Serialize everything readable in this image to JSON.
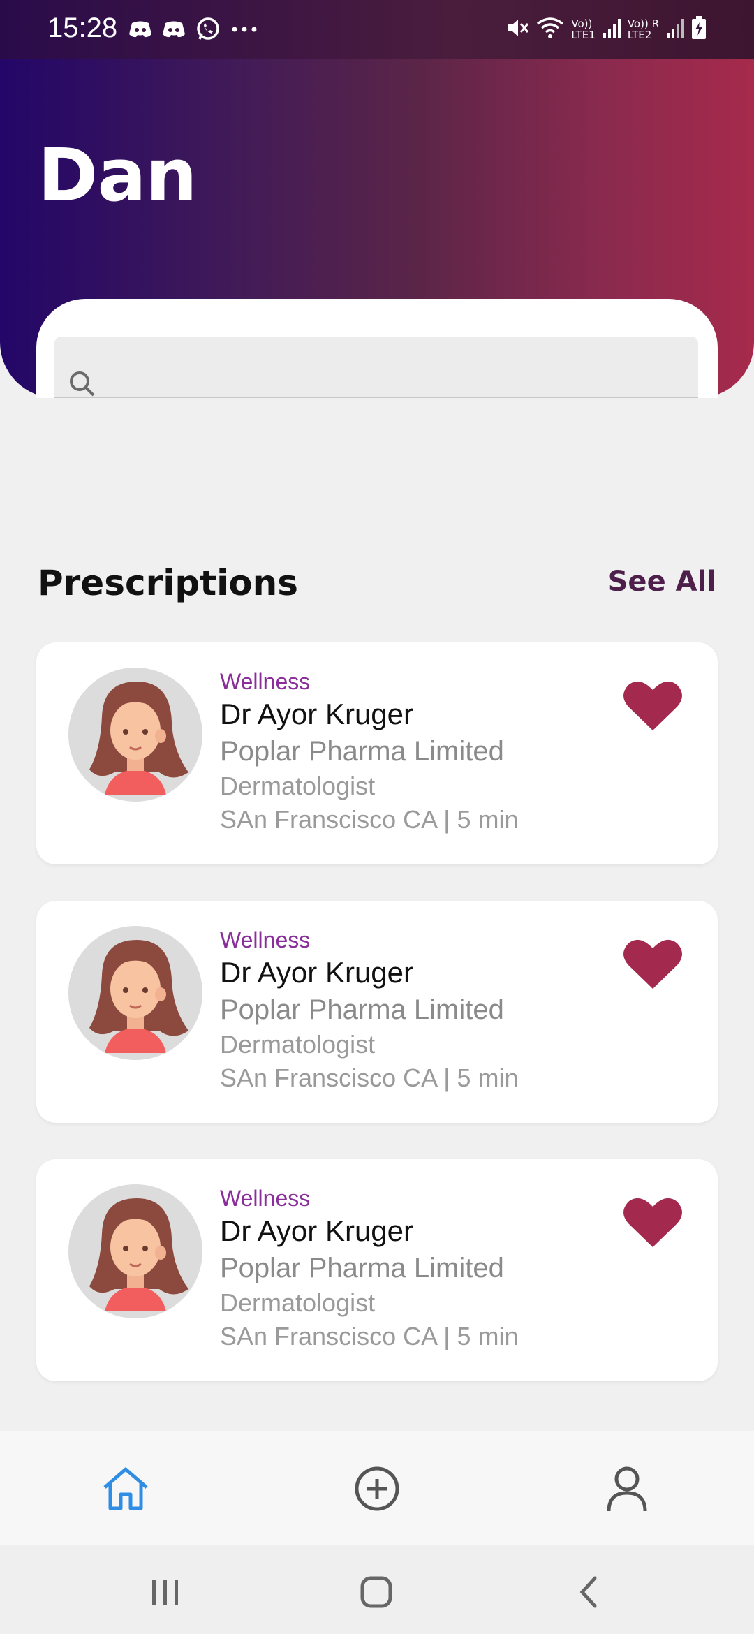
{
  "status_bar": {
    "time": "15:28",
    "left_icons": [
      "discord-icon",
      "discord-icon",
      "whatsapp-icon",
      "more-dots-icon"
    ],
    "right_icons": [
      "mute-icon",
      "wifi-icon",
      "signal-icon",
      "signal-icon",
      "battery-charging-icon"
    ],
    "sim1_top": "Vo))",
    "sim1_bottom": "LTE1",
    "sim2_top": "Vo)) R",
    "sim2_bottom": "LTE2"
  },
  "header": {
    "title": "Dan",
    "gradient_colors": [
      "#230668",
      "#a62a4c"
    ]
  },
  "search": {
    "placeholder": "",
    "value": "",
    "icon": "search-icon"
  },
  "prescriptions": {
    "title": "Prescriptions",
    "see_all": "See All",
    "items": [
      {
        "category": "Wellness",
        "name": "Dr Ayor Kruger",
        "company": "Poplar Pharma Limited",
        "specialty": "Dermatologist",
        "location": "SAn Franscisco CA | 5 min",
        "favorited": true
      },
      {
        "category": "Wellness",
        "name": "Dr Ayor Kruger",
        "company": "Poplar Pharma Limited",
        "specialty": "Dermatologist",
        "location": "SAn Franscisco CA | 5 min",
        "favorited": true
      },
      {
        "category": "Wellness",
        "name": "Dr Ayor Kruger",
        "company": "Poplar Pharma Limited",
        "specialty": "Dermatologist",
        "location": "SAn Franscisco CA | 5 min",
        "favorited": true
      }
    ]
  },
  "bottom_nav": {
    "items": [
      {
        "icon": "home-icon",
        "active": true
      },
      {
        "icon": "add-circle-icon",
        "active": false
      },
      {
        "icon": "profile-icon",
        "active": false
      }
    ],
    "active_color": "#2f8de4"
  },
  "system_nav": {
    "items": [
      "recents-icon",
      "home-icon",
      "back-icon"
    ]
  },
  "colors": {
    "accent": "#4d1f4a",
    "heart": "#a3294f",
    "category": "#8a2e9a"
  }
}
